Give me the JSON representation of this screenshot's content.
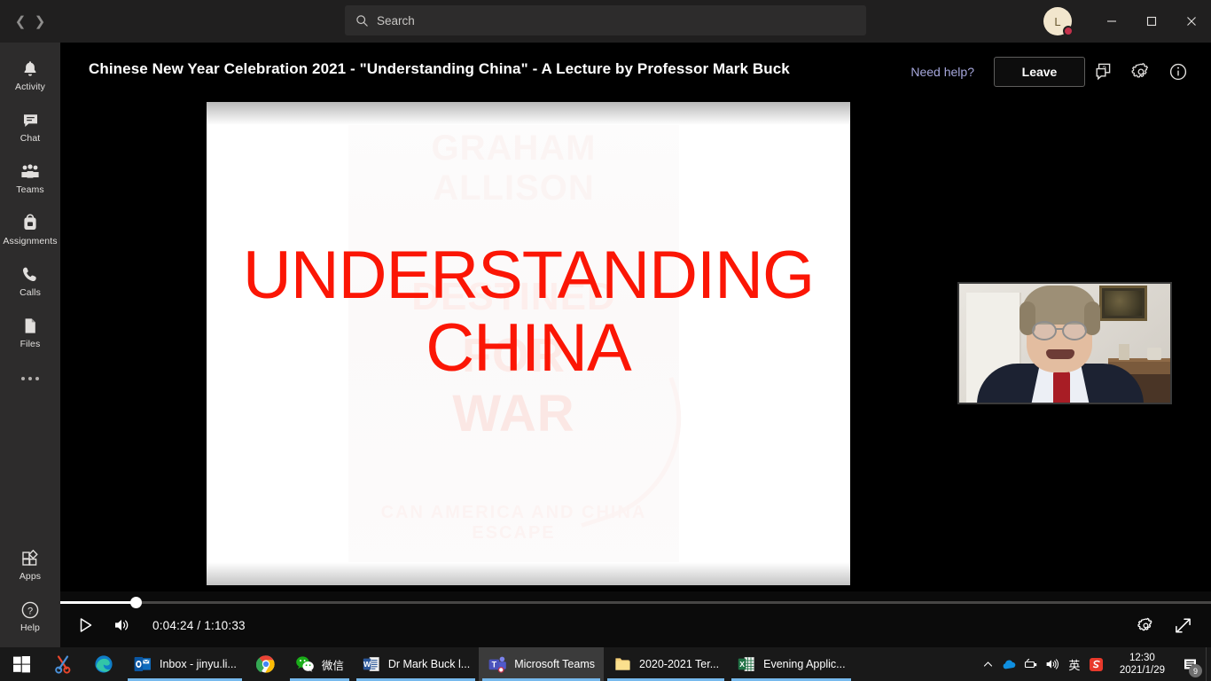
{
  "titlebar": {
    "back_icon": "chevron-left-icon",
    "forward_icon": "chevron-right-icon",
    "search_placeholder": "Search",
    "search_value": "",
    "avatar_initials": "L",
    "presence": "busy",
    "minimize_label": "Minimize",
    "maximize_label": "Maximize",
    "close_label": "Close"
  },
  "rail": {
    "items": [
      {
        "label": "Activity",
        "icon": "bell-icon"
      },
      {
        "label": "Chat",
        "icon": "chat-bubble-icon"
      },
      {
        "label": "Teams",
        "icon": "teams-people-icon"
      },
      {
        "label": "Assignments",
        "icon": "backpack-icon"
      },
      {
        "label": "Calls",
        "icon": "phone-icon"
      },
      {
        "label": "Files",
        "icon": "file-icon"
      }
    ],
    "more_label": "More options",
    "bottom_items": [
      {
        "label": "Apps",
        "icon": "apps-grid-icon"
      },
      {
        "label": "Help",
        "icon": "help-circle-icon"
      }
    ]
  },
  "meeting": {
    "title": "Chinese New Year Celebration 2021 - \"Understanding China\" - A Lecture by Professor Mark Buck",
    "need_help_label": "Need help?",
    "leave_label": "Leave",
    "qa_icon": "qa-chat-icon",
    "settings_icon": "gear-icon",
    "info_icon": "info-circle-icon"
  },
  "slide": {
    "line1": "UNDERSTANDING",
    "line2": "CHINA",
    "text_color": "#fb1605",
    "background_color": "#ffffff",
    "ghost_lines": [
      "GRAHAM ALLISON",
      "DESTINED",
      "FOR",
      "WAR",
      "CAN AMERICA AND CHINA ESCAPE"
    ]
  },
  "speaker_pip": {
    "label": "presenter-video"
  },
  "player": {
    "play_icon": "play-icon",
    "volume_icon": "volume-icon",
    "current_time": "0:04:24",
    "separator": "/",
    "duration": "1:10:33",
    "progress_percent": 6.6,
    "settings_icon": "gear-icon",
    "fullscreen_icon": "expand-icon"
  },
  "taskbar": {
    "start_label": "Start",
    "items": [
      {
        "label": "",
        "icon": "snipping-tool-icon",
        "open": false,
        "active": false,
        "iconly": true
      },
      {
        "label": "",
        "icon": "edge-icon",
        "open": false,
        "active": false,
        "iconly": true
      },
      {
        "label": "Inbox - jinyu.li...",
        "icon": "outlook-icon",
        "open": true,
        "active": false,
        "iconly": false
      },
      {
        "label": "",
        "icon": "chrome-icon",
        "open": false,
        "active": false,
        "iconly": true
      },
      {
        "label": "微信",
        "icon": "wechat-icon",
        "open": true,
        "active": false,
        "iconly": false
      },
      {
        "label": "Dr Mark Buck l...",
        "icon": "word-icon",
        "open": true,
        "active": false,
        "iconly": false
      },
      {
        "label": "Microsoft Teams",
        "icon": "teams-icon",
        "open": true,
        "active": true,
        "iconly": false
      },
      {
        "label": "2020-2021 Ter...",
        "icon": "folder-icon",
        "open": true,
        "active": false,
        "iconly": false
      },
      {
        "label": "Evening Applic...",
        "icon": "excel-icon",
        "open": true,
        "active": false,
        "iconly": false
      }
    ],
    "tray": {
      "overflow_icon": "chevron-up-icon",
      "onedrive_icon": "onedrive-cloud-icon",
      "network_icon": "network-icon",
      "volume_icon": "volume-icon",
      "ime_label": "英",
      "sogou_icon": "sogou-icon",
      "time": "12:30",
      "date": "2021/1/29",
      "notification_icon": "notification-icon",
      "notification_count": "9"
    }
  }
}
